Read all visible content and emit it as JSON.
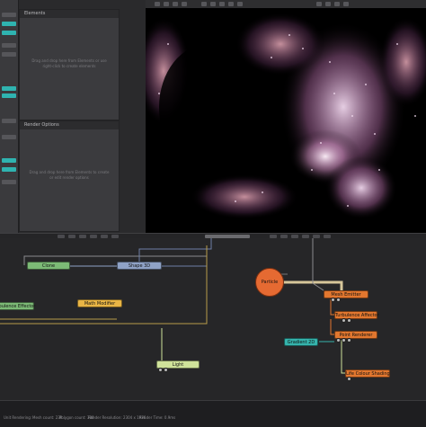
{
  "panels": {
    "elements_title": "Elements",
    "elements_hint": "Drag and drop here from Elements or use right-click to create elements",
    "render_options_title": "Render Options",
    "render_options_hint": "Drag and drop here from Elements to create or edit render options"
  },
  "graph": {
    "nodes": {
      "clone": "Clone",
      "shape3d": "Shape 3D",
      "turbulence_left": "Turbulence  Effector",
      "math_modifier": "Math  Modifier",
      "particle": "Particle",
      "mesh_emitter": "Mesh  Emitter",
      "turbulence_right": "Turbulence  Affector",
      "point_renderer": "Point  Renderer",
      "gradient": "Gradient  2D",
      "light": "Light",
      "life_colour": "Life  Colour  Shading"
    }
  },
  "status": {
    "items": [
      "Unit Rendering:",
      "Mesh count: 230...",
      "Polygon count: 380",
      "Render Resolution: 2304 x 1976",
      "Render Time: 0.9ms"
    ]
  },
  "colors": {
    "accent_teal": "#2fb3b0",
    "node_orange": "#e2772f",
    "node_green": "#7cba76",
    "node_yellow": "#e9b545",
    "node_blue": "#8fa2c6"
  }
}
